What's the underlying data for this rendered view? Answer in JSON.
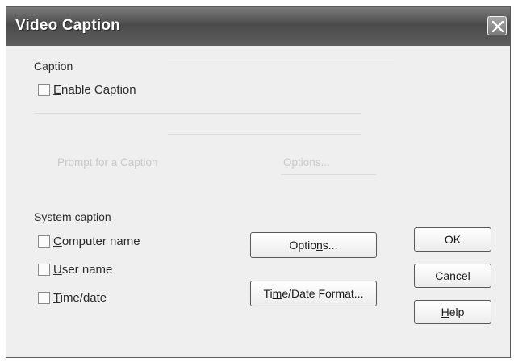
{
  "window": {
    "title": "Video Caption",
    "close_icon": "close-icon"
  },
  "caption_group": {
    "label": "Caption",
    "enable_checkbox": {
      "pre": "",
      "accel": "E",
      "post": "nable Caption",
      "checked": false
    },
    "prompt_label": "Prompt for a Caption",
    "options_button": {
      "label": "Options..."
    }
  },
  "system_group": {
    "label": "System caption",
    "computer_name": {
      "pre": "",
      "accel": "C",
      "post": "omputer name",
      "checked": false
    },
    "user_name": {
      "pre": "",
      "accel": "U",
      "post": "ser name",
      "checked": false
    },
    "time_date": {
      "pre": "",
      "accel": "T",
      "post": "ime/date",
      "checked": false
    },
    "options_button": {
      "pre": "Optio",
      "accel": "n",
      "post": "s..."
    },
    "format_button": {
      "pre": "Ti",
      "accel": "m",
      "post": "e/Date Format..."
    }
  },
  "buttons": {
    "ok": "OK",
    "cancel": "Cancel",
    "help": {
      "pre": "",
      "accel": "H",
      "post": "elp"
    }
  }
}
